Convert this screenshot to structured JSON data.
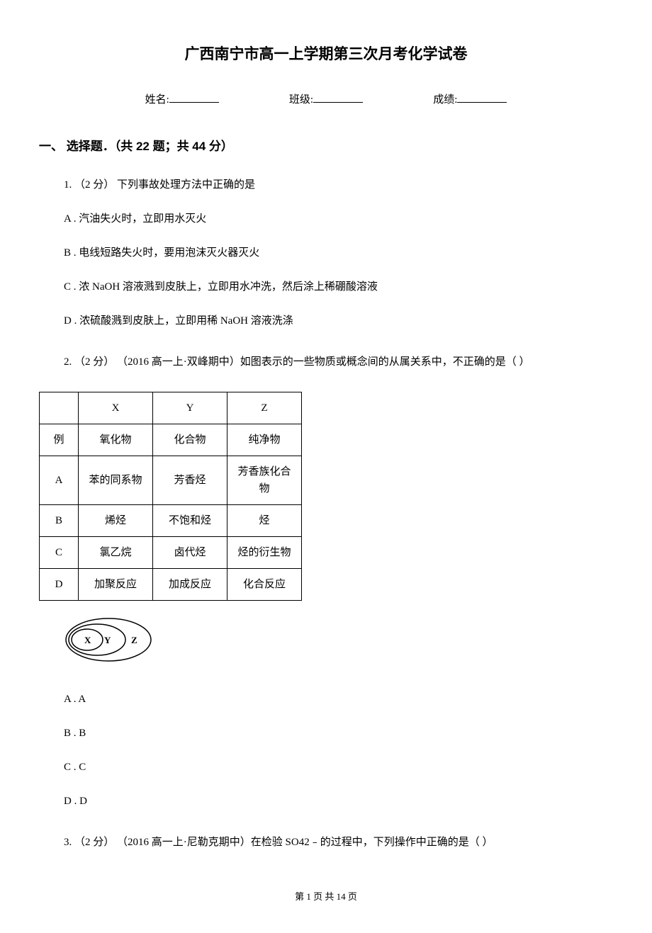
{
  "title": "广西南宁市高一上学期第三次月考化学试卷",
  "info": {
    "name_label": "姓名:",
    "class_label": "班级:",
    "score_label": "成绩:"
  },
  "section1": {
    "header": "一、 选择题．（共 22 题；共 44 分）"
  },
  "q1": {
    "stem_prefix": "1. （2 分） ",
    "stem": "下列事故处理方法中正确的是",
    "optA": "A . 汽油失火时，立即用水灭火",
    "optB": "B . 电线短路失火时，要用泡沫灭火器灭火",
    "optC": "C . 浓 NaOH 溶液溅到皮肤上，立即用水冲洗，然后涂上稀硼酸溶液",
    "optD": "D . 浓硫酸溅到皮肤上，立即用稀 NaOH 溶液洗涤"
  },
  "q2": {
    "stem_prefix": "2. （2 分） ",
    "stem_source": "（2016 高一上·双峰期中）",
    "stem": "如图表示的一些物质或概念间的从属关系中，不正确的是（    ）",
    "table": {
      "headers": [
        "",
        "X",
        "Y",
        "Z"
      ],
      "rows": [
        [
          "例",
          "氧化物",
          "化合物",
          "纯净物"
        ],
        [
          "A",
          "苯的同系物",
          "芳香烃",
          "芳香族化合物"
        ],
        [
          "B",
          "烯烃",
          "不饱和烃",
          "烃"
        ],
        [
          "C",
          "氯乙烷",
          "卤代烃",
          "烃的衍生物"
        ],
        [
          "D",
          "加聚反应",
          "加成反应",
          "化合反应"
        ]
      ]
    },
    "diagram_labels": {
      "x": "X",
      "y": "Y",
      "z": "Z"
    },
    "optA": "A . A",
    "optB": "B . B",
    "optC": "C . C",
    "optD": "D . D"
  },
  "q3": {
    "stem_prefix": "3. （2 分） ",
    "stem_source": "（2016 高一上·尼勒克期中）",
    "stem": "在检验 SO42﹣的过程中，下列操作中正确的是（    ）"
  },
  "footer": {
    "text": "第 1 页 共 14 页"
  }
}
